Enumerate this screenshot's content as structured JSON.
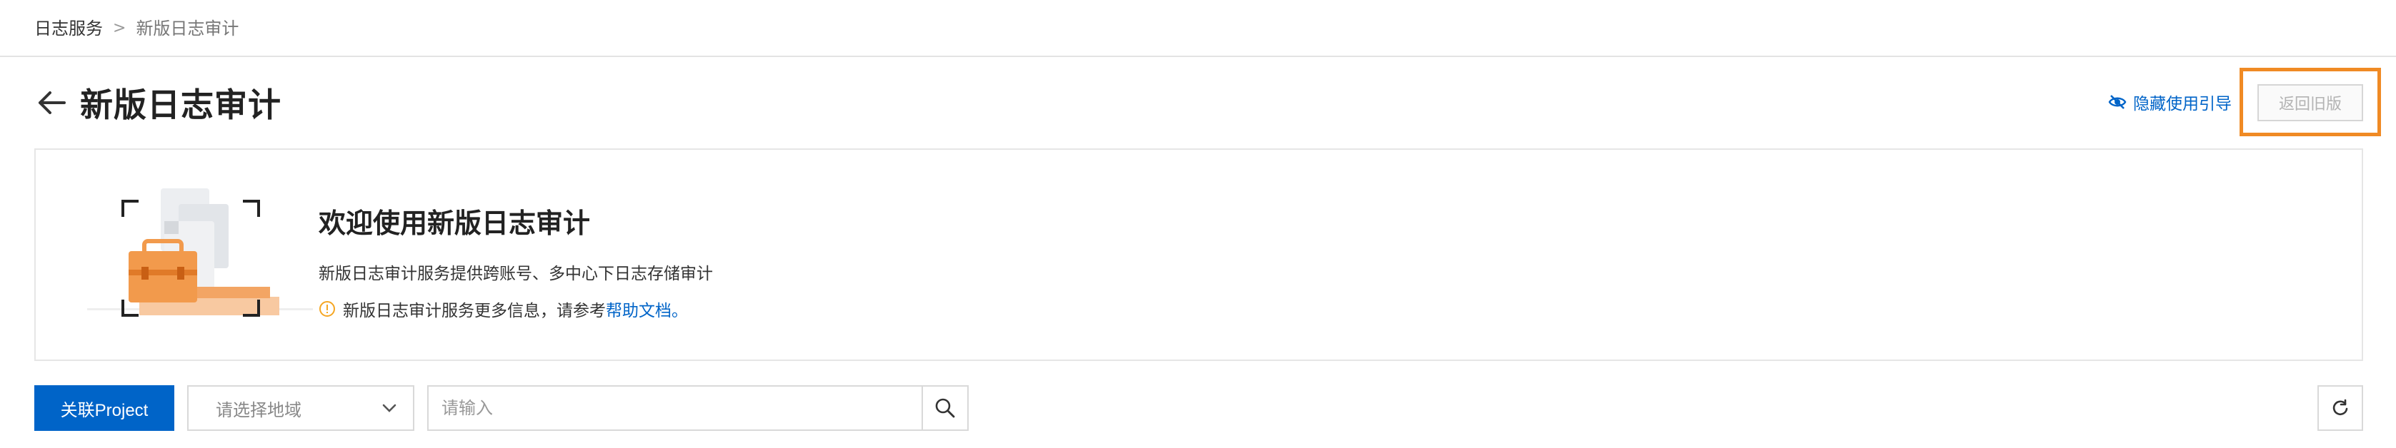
{
  "breadcrumb": {
    "root": "日志服务",
    "separator": ">",
    "current": "新版日志审计"
  },
  "page": {
    "title": "新版日志审计",
    "back_icon": "arrow-left-icon"
  },
  "header_actions": {
    "hide_guide_label": "隐藏使用引导",
    "hide_guide_icon": "eye-slash-icon",
    "return_label": "返回旧版"
  },
  "welcome": {
    "title": "欢迎使用新版日志审计",
    "description": "新版日志审计服务提供跨账号、多中心下日志存储审计",
    "note_prefix": "新版日志审计服务更多信息，请参考",
    "note_link": "帮助文档",
    "note_suffix": "。",
    "note_icon": "info-circle-icon"
  },
  "toolbar": {
    "link_project_label": "关联Project",
    "region_placeholder": "请选择地域",
    "search_placeholder": "请输入",
    "search_icon": "search-icon",
    "refresh_icon": "refresh-icon"
  },
  "colors": {
    "primary": "#0064c8",
    "highlight": "#f08a24",
    "illustration_orange": "#f29a4c"
  }
}
